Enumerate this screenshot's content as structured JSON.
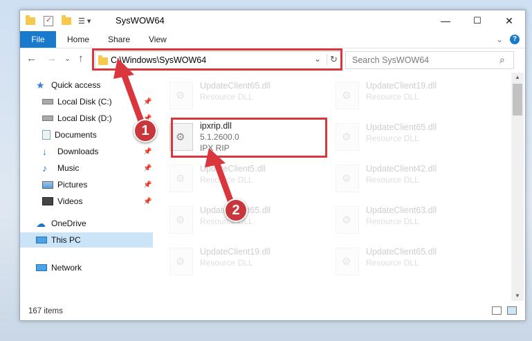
{
  "window": {
    "title": "SysWOW64",
    "minimize": "—",
    "maximize": "☐",
    "close": "✕"
  },
  "ribbon": {
    "tabs": [
      "File",
      "Home",
      "Share",
      "View"
    ],
    "expand": "⌄",
    "help": "?"
  },
  "address": {
    "back": "←",
    "forward": "→",
    "recent": "⌄",
    "up": "↑",
    "path": "C:\\Windows\\SysWOW64",
    "dropdown": "⌄",
    "refresh": "↻",
    "search_placeholder": "Search SysWOW64",
    "search_icon": "⌕"
  },
  "nav": {
    "items": [
      {
        "label": "Quick access",
        "icon": "star-icon"
      },
      {
        "label": "Local Disk (C:)",
        "icon": "drive-icon",
        "pinned": true
      },
      {
        "label": "Local Disk (D:)",
        "icon": "drive-icon",
        "pinned": true
      },
      {
        "label": "Documents",
        "icon": "documents-icon",
        "pinned": true
      },
      {
        "label": "Downloads",
        "icon": "downloads-icon",
        "pinned": true
      },
      {
        "label": "Music",
        "icon": "music-icon",
        "pinned": true
      },
      {
        "label": "Pictures",
        "icon": "pictures-icon",
        "pinned": true
      },
      {
        "label": "Videos",
        "icon": "videos-icon",
        "pinned": true
      },
      {
        "label": "OneDrive",
        "icon": "cloud-icon"
      },
      {
        "label": "This PC",
        "icon": "computer-icon",
        "selected": true
      },
      {
        "label": "Network",
        "icon": "network-icon"
      }
    ],
    "pin_glyph": "📌"
  },
  "files": {
    "col1": [
      {
        "name": "UpdateClient65.dll",
        "type": "Resource DLL"
      },
      {
        "name": "ipxrip.dll",
        "version": "5.1.2600.0",
        "type": "IPX RIP"
      },
      {
        "name": "UpdateClient5.dll",
        "type": "Resource DLL"
      },
      {
        "name": "UpdateClient65.dll",
        "type": "Resource DLL"
      },
      {
        "name": "UpdateClient19.dll",
        "type": "Resource DLL"
      }
    ],
    "col2": [
      {
        "name": "UpdateClient19.dll",
        "type": "Resource DLL"
      },
      {
        "name": "UpdateClient65.dll",
        "type": "Resource DLL"
      },
      {
        "name": "UpdateClient42.dll",
        "type": "Resource DLL"
      },
      {
        "name": "UpdateClient63.dll",
        "type": "Resource DLL"
      },
      {
        "name": "UpdateClient65.dll",
        "type": "Resource DLL"
      }
    ]
  },
  "status": {
    "count": "167 items"
  },
  "annotations": {
    "step1": "1",
    "step2": "2"
  },
  "colors": {
    "accent": "#1979ca",
    "highlight": "#d9363e"
  }
}
